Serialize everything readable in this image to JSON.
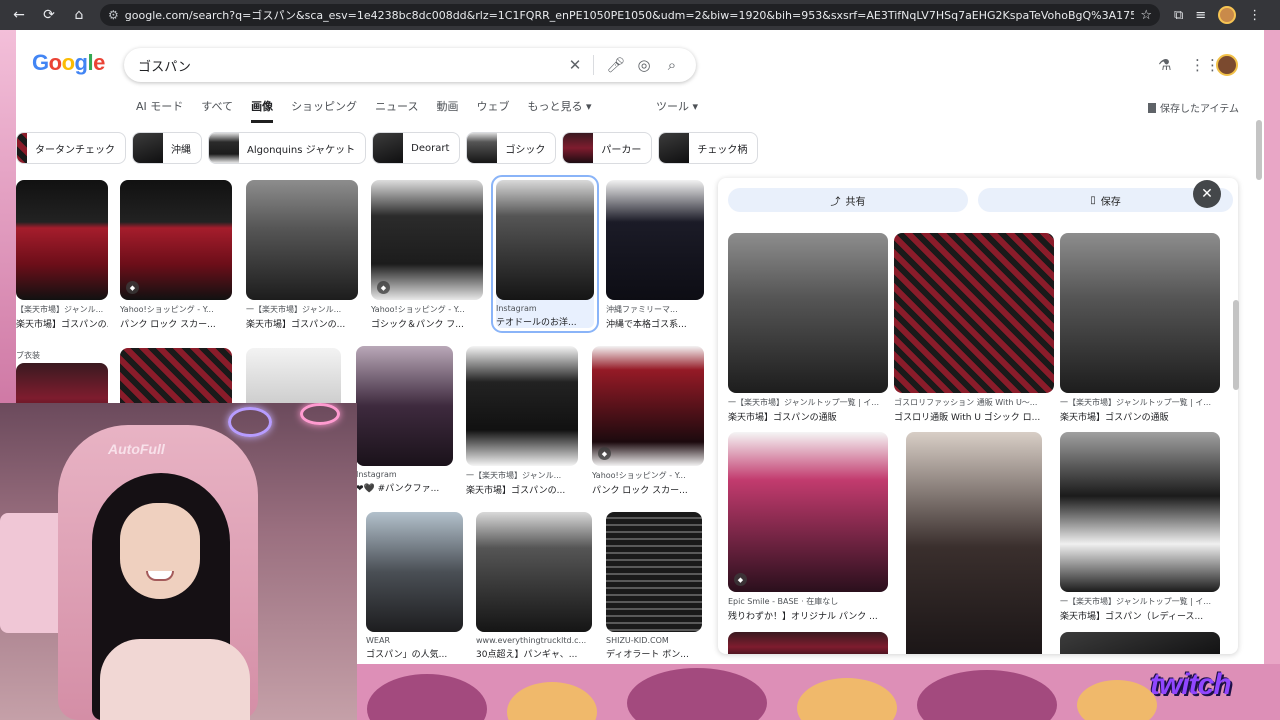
{
  "browser": {
    "url": "google.com/search?q=ゴスパン&sca_esv=1e4238bc8dc008dd&rlz=1C1FQRR_enPE1050PE1050&udm=2&biw=1920&bih=953&sxsrf=AE3TifNqLV7HSq7aEHG2KspaTeVohoBgQ%3A1759905312401&ei=IAbmaLuhGMfg2roP7rLTsAk&ved=0ahUK..."
  },
  "google": {
    "logo": "Google",
    "query": "ゴスパン",
    "tabs": [
      "AI モード",
      "すべて",
      "画像",
      "ショッピング",
      "ニュース",
      "動画",
      "ウェブ",
      "もっと見る ▾"
    ],
    "active_tab": "画像",
    "tools": "ツール ▾",
    "saved_items": "保存したアイテム",
    "chips": [
      "タータンチェック",
      "沖縄",
      "Algonquins ジャケット",
      "Deorart",
      "ゴシック",
      "パーカー",
      "チェック柄"
    ]
  },
  "results": [
    {
      "source": "【楽天市場】ジャンル...",
      "title": "楽天市場】ゴスパンの..."
    },
    {
      "source": "Yahoo!ショッピング - Y...",
      "title": "パンク ロック スカー..."
    },
    {
      "source": "一【楽天市場】ジャンル...",
      "title": "楽天市場】ゴスパンの..."
    },
    {
      "source": "Yahoo!ショッピング - Y...",
      "title": "ゴシック＆パンク フ..."
    },
    {
      "source": "Instagram",
      "title": "テオドールのお洋..."
    },
    {
      "source": "沖縄ファミリーマ...",
      "title": "沖縄で本格ゴス系..."
    },
    {
      "source": "ブ衣装",
      "title": ""
    },
    {
      "source": "",
      "title": ""
    },
    {
      "source": "",
      "title": ""
    },
    {
      "source": "Instagram",
      "title": "❤🖤 #パンクファ..."
    },
    {
      "source": "一【楽天市場】ジャンル...",
      "title": "楽天市場】ゴスパンの..."
    },
    {
      "source": "Yahoo!ショッピング - Y...",
      "title": "パンク ロック スカー..."
    },
    {
      "source": "WEAR",
      "title": "ゴスパン」の人気..."
    },
    {
      "source": "www.everythingtruckltd.c...",
      "title": "30点超え】パンギャ、..."
    },
    {
      "source": "SHIZU-KID.COM",
      "title": "ディオラート ボン..."
    }
  ],
  "panel": {
    "share": "共有",
    "save": "保存",
    "close": "✕",
    "items": [
      {
        "source": "一【楽天市場】ジャンルトップ一覧 | イ...",
        "title": "楽天市場】ゴスパンの通販"
      },
      {
        "source": "ゴスロリファッション 通販 With U〜...",
        "title": "ゴスロリ通販 With U ゴシック ロ..."
      },
      {
        "source": "一【楽天市場】ジャンルトップ一覧 | イ...",
        "title": "楽天市場】ゴスパンの通販"
      },
      {
        "source": "Epic Smile - BASE · 在庫なし",
        "title": "残りわずか！】オリジナル パンク ..."
      },
      {
        "source": "",
        "title": ""
      },
      {
        "source": "一【楽天市場】ジャンルトップ一覧 | イ...",
        "title": "楽天市場】ゴスパン（レディース..."
      }
    ]
  },
  "webcam": {
    "chair_brand": "AutoFull"
  },
  "overlay": {
    "twitch": "twitch"
  }
}
